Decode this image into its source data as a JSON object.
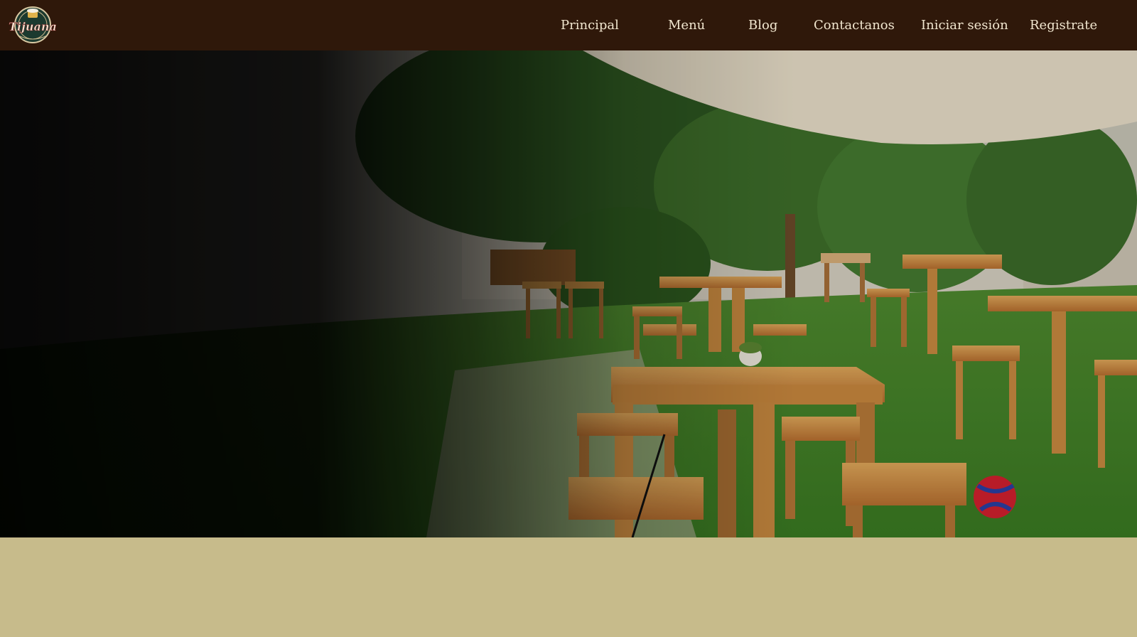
{
  "brand": {
    "logo_icon": "restaurant-logo-icon",
    "logo_text": "Tijuana"
  },
  "nav": {
    "items": [
      {
        "label": "Principal"
      },
      {
        "label": "Menú"
      },
      {
        "label": "Blog"
      },
      {
        "label": "Contactanos"
      },
      {
        "label": "Iniciar sesión"
      },
      {
        "label": "Registrate"
      }
    ]
  },
  "hero": {
    "image": "garden-terrace-photo",
    "description_icon": "outdoor-wooden-tables-image"
  },
  "colors": {
    "navbar_bg": "#2f180a",
    "nav_text": "#f1e6cf",
    "page_bg": "#c7bb8b"
  }
}
